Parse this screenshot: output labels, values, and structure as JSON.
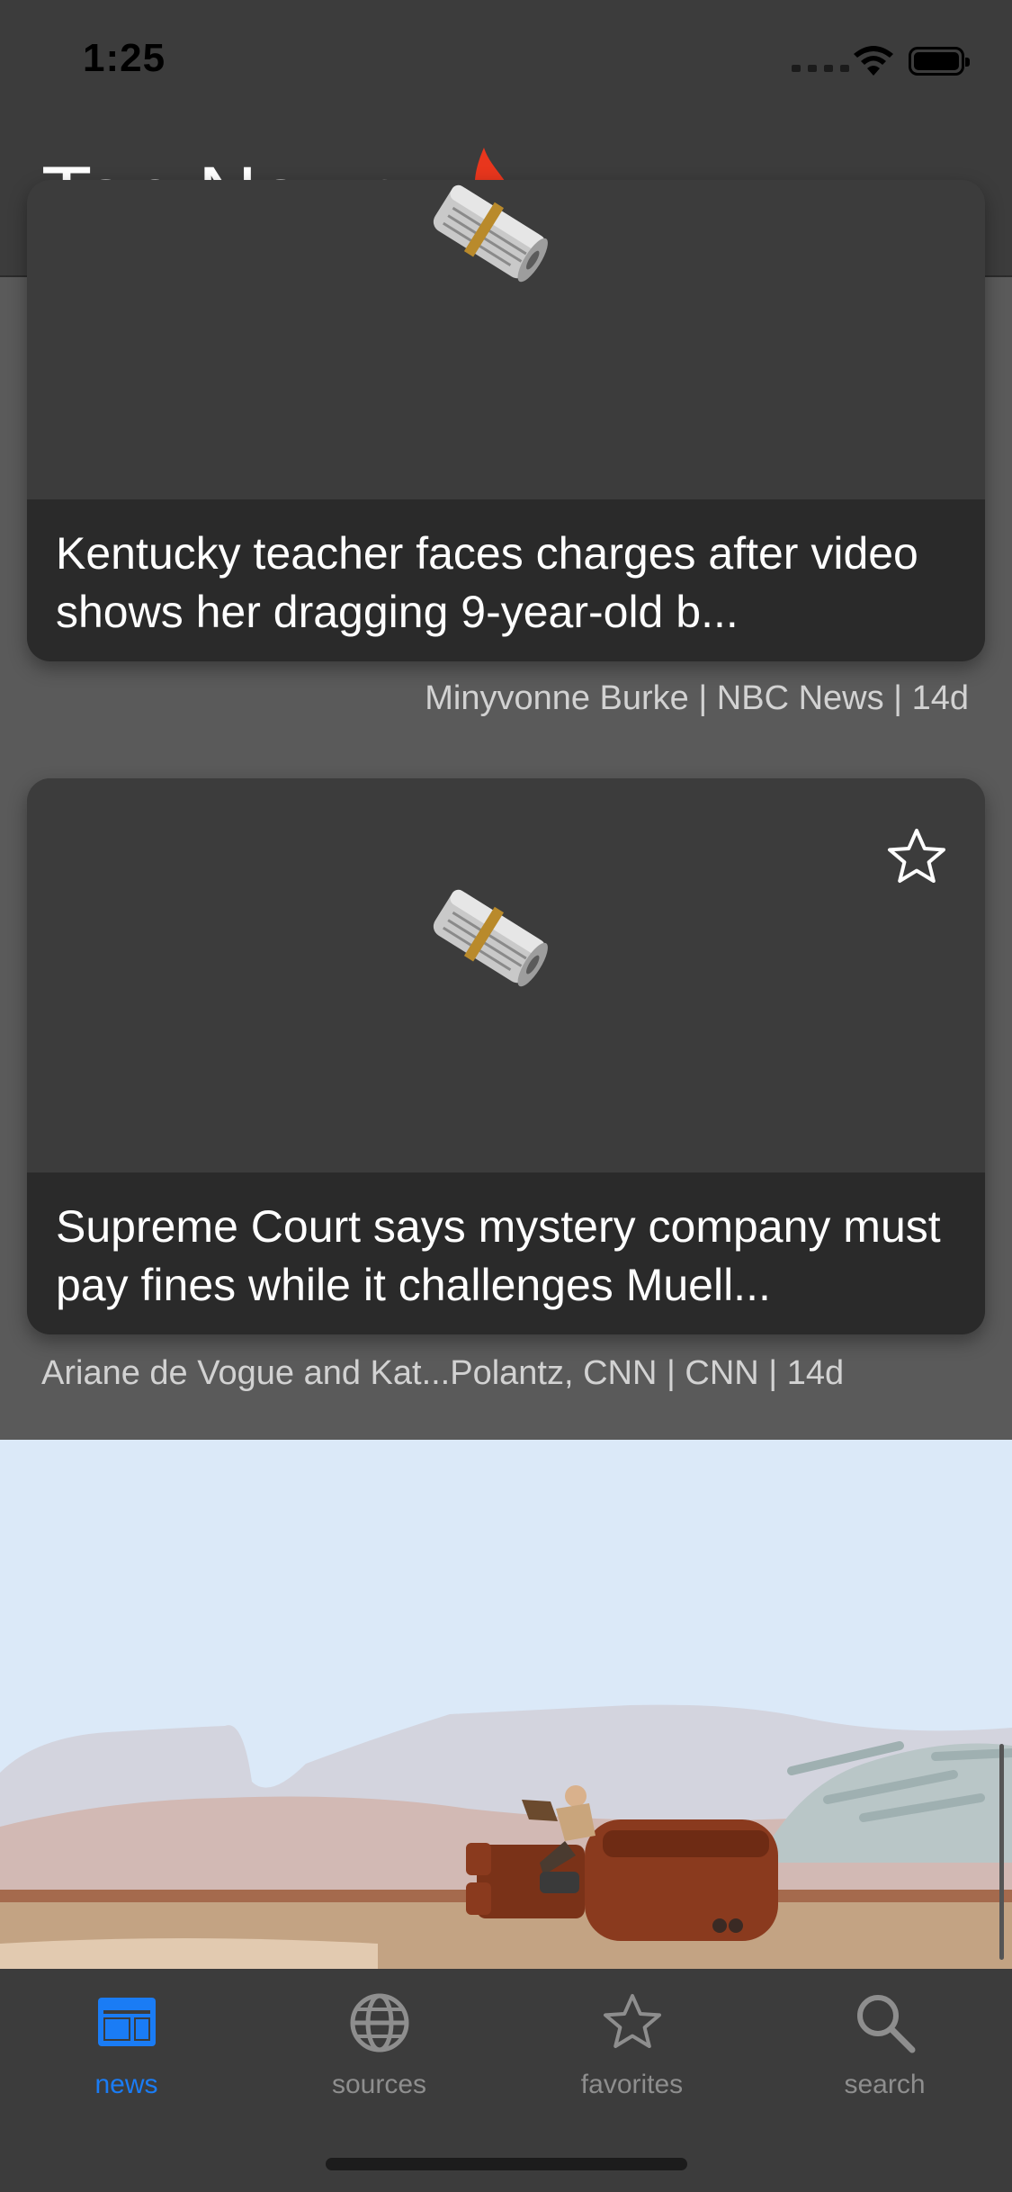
{
  "status_bar": {
    "time": "1:25"
  },
  "header": {
    "title": "Top News",
    "title_icon": "flame-icon"
  },
  "articles": [
    {
      "title": "Kentucky teacher faces charges after video shows her dragging 9-year-old b...",
      "meta": "Minyvonne Burke | NBC News | 14d",
      "image_icon": "newspaper-icon"
    },
    {
      "title": "Supreme Court says mystery company must pay fines while it challenges Muell...",
      "meta": "Ariane de Vogue and Kat...Polantz, CNN | CNN | 14d",
      "image_icon": "newspaper-icon",
      "favorite_icon": "star-outline-icon"
    }
  ],
  "tab_bar": {
    "active": "news",
    "tabs": [
      {
        "label": "news",
        "icon": "news-icon"
      },
      {
        "label": "sources",
        "icon": "globe-icon"
      },
      {
        "label": "favorites",
        "icon": "star-icon"
      },
      {
        "label": "search",
        "icon": "search-icon"
      }
    ]
  },
  "colors": {
    "accent": "#1a7cf5",
    "background": "#5a5a5a",
    "bar": "#3c3c3c",
    "caption": "#2a2a2a"
  }
}
